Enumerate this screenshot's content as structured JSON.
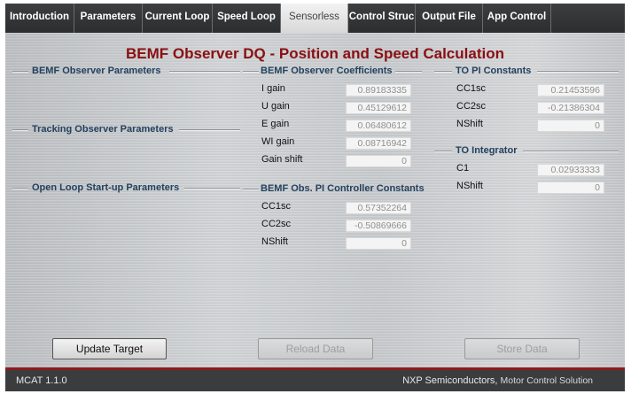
{
  "tabs": [
    {
      "label": "Introduction",
      "active": false
    },
    {
      "label": "Parameters",
      "active": false
    },
    {
      "label": "Current Loop",
      "active": false
    },
    {
      "label": "Speed Loop",
      "active": false
    },
    {
      "label": "Sensorless",
      "active": true
    },
    {
      "label": "Control Struc",
      "active": false
    },
    {
      "label": "Output File",
      "active": false
    },
    {
      "label": "App Control",
      "active": false
    }
  ],
  "page_title": "BEMF Observer DQ - Position and Speed Calculation",
  "left_sections": {
    "bemf_observer_parameters": "BEMF Observer Parameters",
    "tracking_observer_parameters": "Tracking Observer Parameters",
    "open_loop_startup_parameters": "Open Loop Start-up Parameters"
  },
  "bemf_coefficients": {
    "heading": "BEMF Observer Coefficients",
    "rows": [
      {
        "label": "I gain",
        "value": "0.89183335"
      },
      {
        "label": "U gain",
        "value": "0.45129612"
      },
      {
        "label": "E gain",
        "value": "0.06480612"
      },
      {
        "label": "WI gain",
        "value": "0.08716942"
      },
      {
        "label": "Gain shift",
        "value": "0"
      }
    ]
  },
  "bemf_pi_constants": {
    "heading": "BEMF Obs. PI Controller Constants",
    "rows": [
      {
        "label": "CC1sc",
        "value": "0.57352264"
      },
      {
        "label": "CC2sc",
        "value": "-0.50869666"
      },
      {
        "label": "NShift",
        "value": "0"
      }
    ]
  },
  "to_pi_constants": {
    "heading": "TO PI Constants",
    "rows": [
      {
        "label": "CC1sc",
        "value": "0.21453596"
      },
      {
        "label": "CC2sc",
        "value": "-0.21386304"
      },
      {
        "label": "NShift",
        "value": "0"
      }
    ]
  },
  "to_integrator": {
    "heading": "TO Integrator",
    "rows": [
      {
        "label": "C1",
        "value": "0.02933333"
      },
      {
        "label": "NShift",
        "value": "0"
      }
    ]
  },
  "buttons": {
    "update_target": "Update Target",
    "reload_data": "Reload Data",
    "store_data": "Store Data"
  },
  "status_bar": {
    "version": "MCAT 1.1.0",
    "company": "NXP Semiconductors,",
    "product": "Motor Control Solution"
  },
  "colors": {
    "title": "#8a0f12",
    "section_heading": "#24415f",
    "tab_bar": "#2f3133",
    "accent_red": "#8f1a1c"
  }
}
